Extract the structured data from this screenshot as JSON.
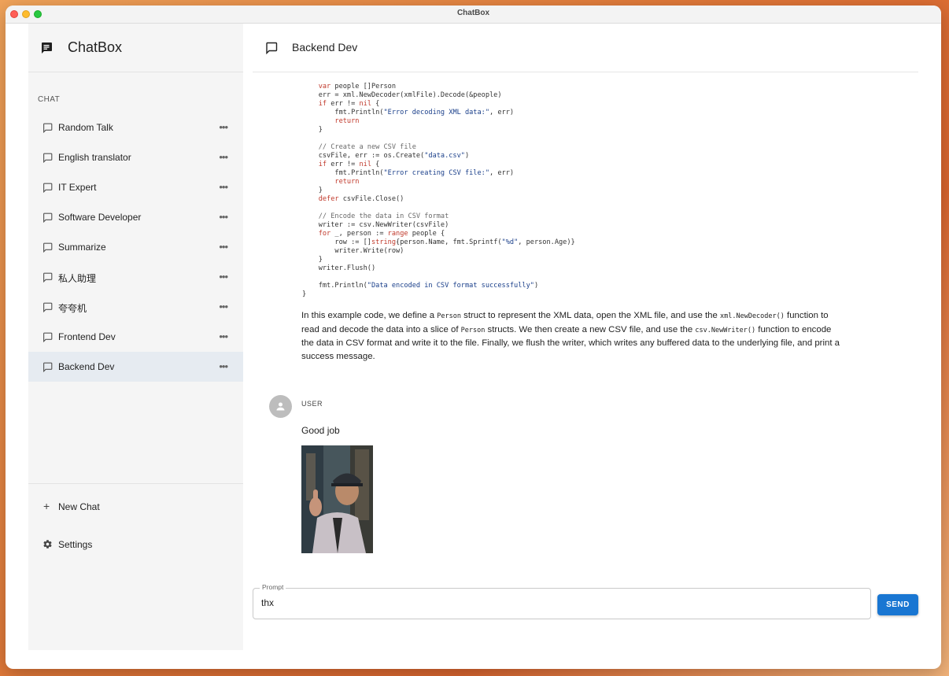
{
  "window": {
    "title": "ChatBox"
  },
  "sidebar": {
    "brand": "ChatBox",
    "section_label": "CHAT",
    "sessions": [
      {
        "label": "Random Talk"
      },
      {
        "label": "English translator"
      },
      {
        "label": "IT Expert"
      },
      {
        "label": "Software Developer"
      },
      {
        "label": "Summarize"
      },
      {
        "label": "私人助理"
      },
      {
        "label": "夸夸机"
      },
      {
        "label": "Frontend Dev"
      },
      {
        "label": "Backend Dev",
        "active": true
      }
    ],
    "more_glyph": "•••",
    "new_chat_label": "New Chat",
    "new_chat_glyph": "+",
    "settings_label": "Settings"
  },
  "header": {
    "title": "Backend Dev"
  },
  "assistant_message": {
    "code_lines": [
      [
        {
          "t": "    "
        },
        {
          "t": "var",
          "c": "kw"
        },
        {
          "t": " people []Person"
        }
      ],
      [
        {
          "t": "    err = xml.NewDecoder(xmlFile).Decode(&people)"
        }
      ],
      [
        {
          "t": "    "
        },
        {
          "t": "if",
          "c": "kw"
        },
        {
          "t": " err != "
        },
        {
          "t": "nil",
          "c": "kw"
        },
        {
          "t": " {"
        }
      ],
      [
        {
          "t": "        fmt.Println("
        },
        {
          "t": "\"Error decoding XML data:\"",
          "c": "str"
        },
        {
          "t": ", err)"
        }
      ],
      [
        {
          "t": "        "
        },
        {
          "t": "return",
          "c": "kw"
        }
      ],
      [
        {
          "t": "    }"
        }
      ],
      [
        {
          "t": ""
        }
      ],
      [
        {
          "t": "    "
        },
        {
          "t": "// Create a new CSV file",
          "c": "cm"
        }
      ],
      [
        {
          "t": "    csvFile, err := os.Create("
        },
        {
          "t": "\"data.csv\"",
          "c": "str"
        },
        {
          "t": ")"
        }
      ],
      [
        {
          "t": "    "
        },
        {
          "t": "if",
          "c": "kw"
        },
        {
          "t": " err != "
        },
        {
          "t": "nil",
          "c": "kw"
        },
        {
          "t": " {"
        }
      ],
      [
        {
          "t": "        fmt.Println("
        },
        {
          "t": "\"Error creating CSV file:\"",
          "c": "str"
        },
        {
          "t": ", err)"
        }
      ],
      [
        {
          "t": "        "
        },
        {
          "t": "return",
          "c": "kw"
        }
      ],
      [
        {
          "t": "    }"
        }
      ],
      [
        {
          "t": "    "
        },
        {
          "t": "defer",
          "c": "kw"
        },
        {
          "t": " csvFile.Close()"
        }
      ],
      [
        {
          "t": ""
        }
      ],
      [
        {
          "t": "    "
        },
        {
          "t": "// Encode the data in CSV format",
          "c": "cm"
        }
      ],
      [
        {
          "t": "    writer := csv.NewWriter(csvFile)"
        }
      ],
      [
        {
          "t": "    "
        },
        {
          "t": "for",
          "c": "kw"
        },
        {
          "t": " _, person := "
        },
        {
          "t": "range",
          "c": "kw"
        },
        {
          "t": " people {"
        }
      ],
      [
        {
          "t": "        row := []"
        },
        {
          "t": "string",
          "c": "kw"
        },
        {
          "t": "{person.Name, fmt.Sprintf("
        },
        {
          "t": "\"%d\"",
          "c": "str"
        },
        {
          "t": ", person.Age)}"
        }
      ],
      [
        {
          "t": "        writer.Write(row)"
        }
      ],
      [
        {
          "t": "    }"
        }
      ],
      [
        {
          "t": "    writer.Flush()"
        }
      ],
      [
        {
          "t": ""
        }
      ],
      [
        {
          "t": "    fmt.Println("
        },
        {
          "t": "\"Data encoded in CSV format successfully\"",
          "c": "str"
        },
        {
          "t": ")"
        }
      ],
      [
        {
          "t": "}"
        }
      ]
    ],
    "explanation_parts": [
      {
        "t": "In this example code, we define a "
      },
      {
        "t": "Person",
        "code": true
      },
      {
        "t": " struct to represent the XML data, open the XML file, and use the "
      },
      {
        "t": "xml.NewDecoder()",
        "code": true
      },
      {
        "t": " function to read and decode the data into a slice of "
      },
      {
        "t": "Person",
        "code": true
      },
      {
        "t": " structs. We then create a new CSV file, and use the "
      },
      {
        "t": "csv.NewWriter()",
        "code": true
      },
      {
        "t": " function to encode the data in CSV format and write it to the file. Finally, we flush the writer, which writes any buffered data to the underlying file, and print a success message."
      }
    ]
  },
  "user_message": {
    "role": "USER",
    "text": "Good job"
  },
  "prompt": {
    "legend": "Prompt",
    "value": "thx"
  },
  "send_label": "SEND",
  "colors": {
    "accent": "#1976d2",
    "active_session": "#e6ebf1",
    "keyword": "#c0392b",
    "string": "#1a3f8a"
  }
}
